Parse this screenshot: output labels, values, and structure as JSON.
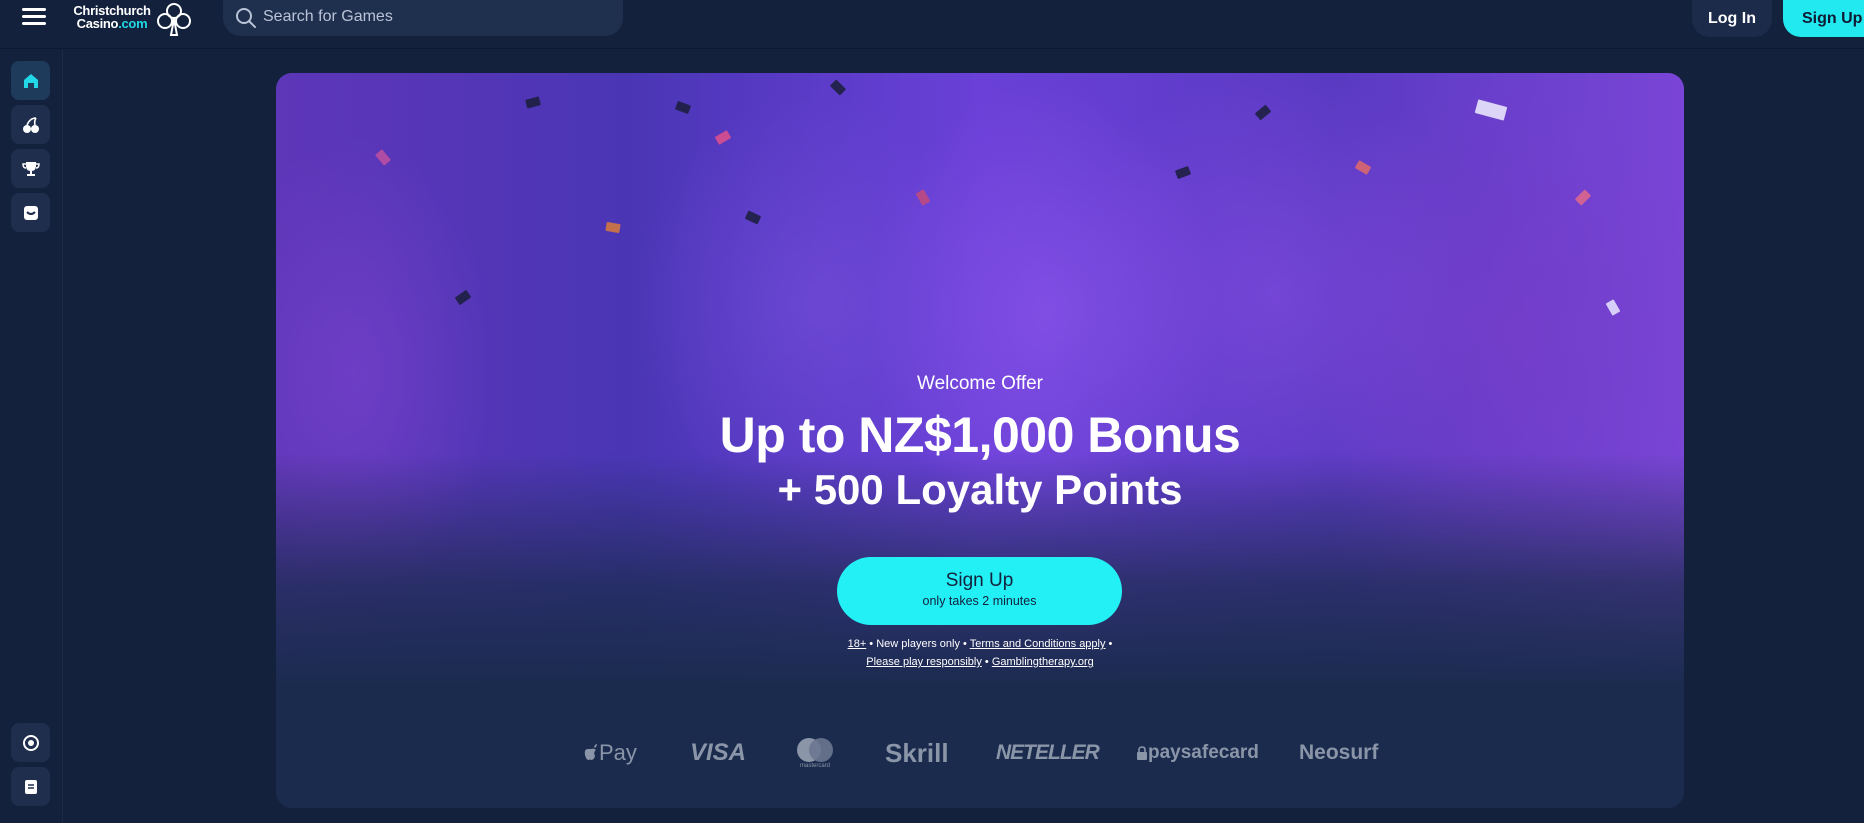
{
  "header": {
    "logo_line1": "Christchurch",
    "logo_line2": "Casino",
    "logo_line2_suffix": ".com",
    "search_placeholder": "Search for Games",
    "login_label": "Log In",
    "signup_label": "Sign Up"
  },
  "sidebar": {
    "items": [
      {
        "icon": "home-icon",
        "active": true
      },
      {
        "icon": "cherries-icon"
      },
      {
        "icon": "trophy-icon"
      },
      {
        "icon": "gift-icon"
      },
      {
        "icon": "support-icon"
      },
      {
        "icon": "document-icon"
      }
    ]
  },
  "hero": {
    "welcome": "Welcome Offer",
    "headline": "Up to NZ$1,000 Bonus",
    "subline": "+ 500 Loyalty Points",
    "cta_label": "Sign Up",
    "cta_sub": "only takes 2 minutes",
    "legal": {
      "age": "18+",
      "sep1": " • New players only • ",
      "terms": "Terms and Conditions apply",
      "sep2": " •",
      "responsible": "Please play responsibly",
      "sep3": " • ",
      "therapy": "Gamblingtherapy.org"
    }
  },
  "payments": {
    "applepay": "Pay",
    "visa": "VISA",
    "mastercard": "mastercard",
    "skrill": "Skrill",
    "neteller": "NETELLER",
    "paysafe": "paysafecard",
    "neosurf": "Neosurf"
  },
  "colors": {
    "background": "#13213d",
    "accent": "#22f0f4",
    "hero_purple": "#6a40d8"
  }
}
